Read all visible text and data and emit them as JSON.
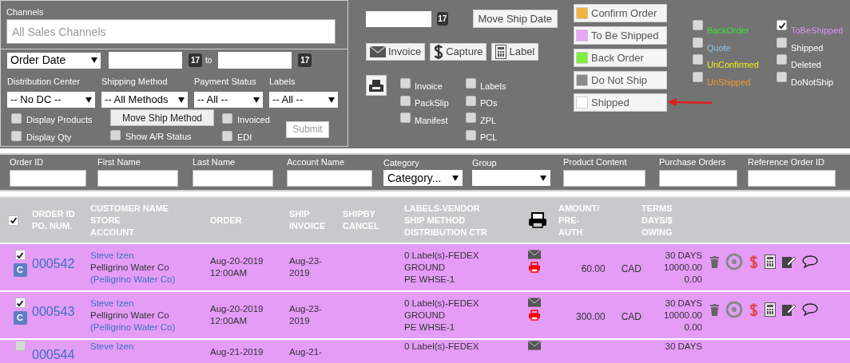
{
  "filters_panel": {
    "channels_label": "Channels",
    "channels_placeholder": "All Sales Channels",
    "date_type": "Order Date",
    "calendar_from": "17",
    "to_label": "to",
    "calendar_to": "17",
    "dropdowns": [
      {
        "label": "Distribution Center",
        "value": "-- No DC --"
      },
      {
        "label": "Shipping Method",
        "value": "-- All Methods"
      },
      {
        "label": "Payment Status",
        "value": "-- All --"
      },
      {
        "label": "Labels",
        "value": "-- All --"
      }
    ],
    "options": [
      {
        "label": "Display Products",
        "checked": false
      },
      {
        "label": "Display Qty",
        "checked": false
      },
      {
        "label": "Show A/R Status",
        "checked": false
      },
      {
        "label": "Invoiced",
        "checked": false
      },
      {
        "label": "EDI",
        "checked": false
      }
    ],
    "move_ship_method": "Move Ship Method",
    "submit": "Submit"
  },
  "ship_date": {
    "calendar": "17",
    "button": "Move Ship Date"
  },
  "actions": [
    {
      "kind": "envelope",
      "label": "Invoice"
    },
    {
      "kind": "dollar",
      "label": "Capture"
    },
    {
      "kind": "calculator",
      "label": "Label"
    }
  ],
  "print_columns": [
    [
      {
        "label": "Invoice",
        "checked": false
      },
      {
        "label": "PackSlip",
        "checked": false
      },
      {
        "label": "Manifest",
        "checked": false
      }
    ],
    [
      {
        "label": "Labels",
        "checked": false
      },
      {
        "label": "POs",
        "checked": false
      },
      {
        "label": "ZPL",
        "checked": false
      },
      {
        "label": "PCL",
        "checked": false
      }
    ]
  ],
  "status_buttons": [
    {
      "label": "Confirm Order",
      "color": "#f5b23e"
    },
    {
      "label": "To Be Shipped",
      "color": "#e9a6f7"
    },
    {
      "label": "Back Order",
      "color": "#7df03e"
    },
    {
      "label": "Do Not Ship",
      "color": "#8a8a8a"
    },
    {
      "label": "Shipped",
      "color": "#ffffff"
    }
  ],
  "legend_columns": [
    [
      {
        "label": "BackOrder",
        "color": "#3ee03e",
        "checked": false
      },
      {
        "label": "Quote",
        "color": "#8ec4ea",
        "checked": false
      },
      {
        "label": "UnConfirmed",
        "color": "#f0f020",
        "checked": false
      },
      {
        "label": "UnShipped",
        "color": "#f29a30",
        "checked": false
      }
    ],
    [
      {
        "label": "ToBeShipped",
        "color": "#dc92f4",
        "checked": true
      },
      {
        "label": "Shipped",
        "color": "#ffffff",
        "checked": false
      },
      {
        "label": "Deleted",
        "color": "#ffffff",
        "checked": false
      },
      {
        "label": "DoNotShip",
        "color": "#ffffff",
        "checked": false
      }
    ]
  ],
  "search_fields": [
    {
      "label": "Order ID",
      "kind": "text"
    },
    {
      "label": "First Name",
      "kind": "text"
    },
    {
      "label": "Last Name",
      "kind": "text"
    },
    {
      "label": "Account Name",
      "kind": "text"
    },
    {
      "label": "Category",
      "kind": "select",
      "value": "Category..."
    },
    {
      "label": "Group",
      "kind": "select"
    },
    {
      "label": "Product Content",
      "kind": "text"
    },
    {
      "label": "Purchase Orders",
      "kind": "text"
    },
    {
      "label": "Reference Order ID",
      "kind": "text"
    }
  ],
  "table": {
    "all_checked": true,
    "columns": [
      {
        "kind": "text",
        "lines": [
          "ORDER ID",
          "PO. NUM."
        ]
      },
      {
        "kind": "text",
        "lines": [
          "CUSTOMER NAME",
          "STORE",
          "ACCOUNT"
        ]
      },
      {
        "kind": "text",
        "lines": [
          "ORDER"
        ]
      },
      {
        "kind": "text",
        "lines": [
          "SHIP",
          "INVOICE"
        ]
      },
      {
        "kind": "text",
        "lines": [
          "SHIPBY",
          "CANCEL"
        ]
      },
      {
        "kind": "text",
        "lines": [
          "LABELS-VENDOR",
          "SHIP METHOD",
          "DISTRIBUTION CTR"
        ]
      },
      {
        "kind": "printer"
      },
      {
        "kind": "text",
        "lines": [
          "AMOUNT/",
          "PRE-",
          "AUTH"
        ]
      },
      {
        "kind": "text",
        "lines": [
          "TERMS",
          "DAYS/$",
          "OWING"
        ]
      }
    ],
    "rows": [
      {
        "checked": true,
        "badge": "C",
        "order_id": "000542",
        "customer": [
          "Steve Izen",
          "Pelligrino Water Co",
          "(Pelligrino Water Co)"
        ],
        "order": [
          "Aug-20-2019",
          "12:00AM"
        ],
        "ship": [
          "Aug-23-",
          "2019"
        ],
        "labels": [
          "0 Label(s)-FEDEX",
          "GROUND",
          "PE WHSE-1"
        ],
        "amount": "60.00",
        "currency": "CAD",
        "terms": [
          "30 DAYS",
          "10000.00",
          "0.00"
        ]
      },
      {
        "checked": true,
        "badge": "C",
        "order_id": "000543",
        "customer": [
          "Steve Izen",
          "Pelligrino Water Co",
          "(Pelligrino Water Co)"
        ],
        "order": [
          "Aug-20-2019",
          "12:00AM"
        ],
        "ship": [
          "Aug-23-",
          "2019"
        ],
        "labels": [
          "0 Label(s)-FEDEX",
          "GROUND",
          "PE WHSE-1"
        ],
        "amount": "300.00",
        "currency": "CAD",
        "terms": [
          "30 DAYS",
          "10000.00",
          "0.00"
        ]
      },
      {
        "checked": false,
        "order_id": "000544",
        "customer": [
          "Steve Izen"
        ],
        "order": [
          "Aug-21-2019"
        ],
        "ship": [
          "Aug-21-"
        ],
        "labels": [
          "0 Label(s)-FEDEX"
        ],
        "terms": [
          "30 DAYS"
        ]
      }
    ]
  }
}
